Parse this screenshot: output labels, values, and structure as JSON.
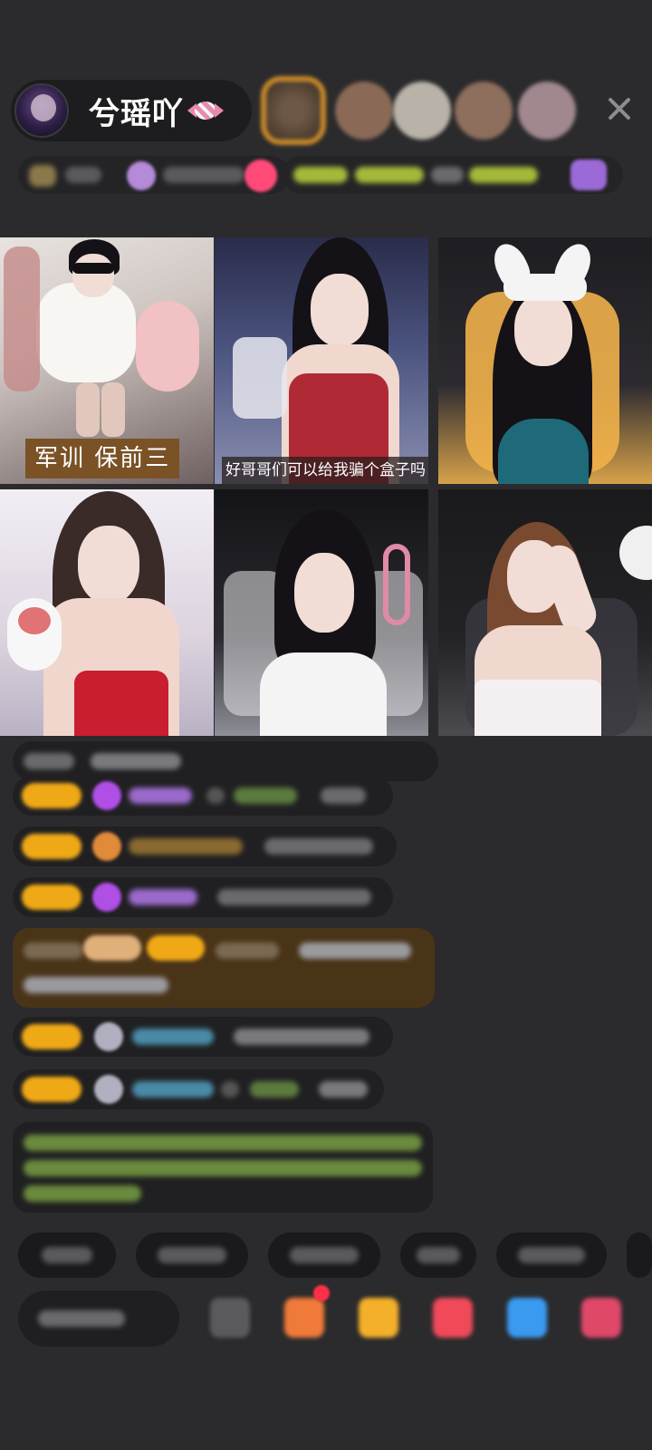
{
  "header": {
    "host_name": "兮瑶吖",
    "host_avatar_icon": "avatar-icon",
    "candy_icon": "candy-icon",
    "close_icon": "close-icon"
  },
  "video_grid": {
    "tiles": [
      {
        "caption": "军训 保前三"
      },
      {
        "caption": "好哥哥们可以给我骗个盒子吗"
      },
      {
        "caption": ""
      },
      {
        "caption": ""
      },
      {
        "caption": ""
      },
      {
        "caption": ""
      }
    ]
  },
  "colors": {
    "background": "#2b2b2d",
    "badge_gold": "#f0a916",
    "caption_brown": "#7a5226",
    "chat_green": "#8fcf4e",
    "gem_purple": "#b04fe6"
  }
}
